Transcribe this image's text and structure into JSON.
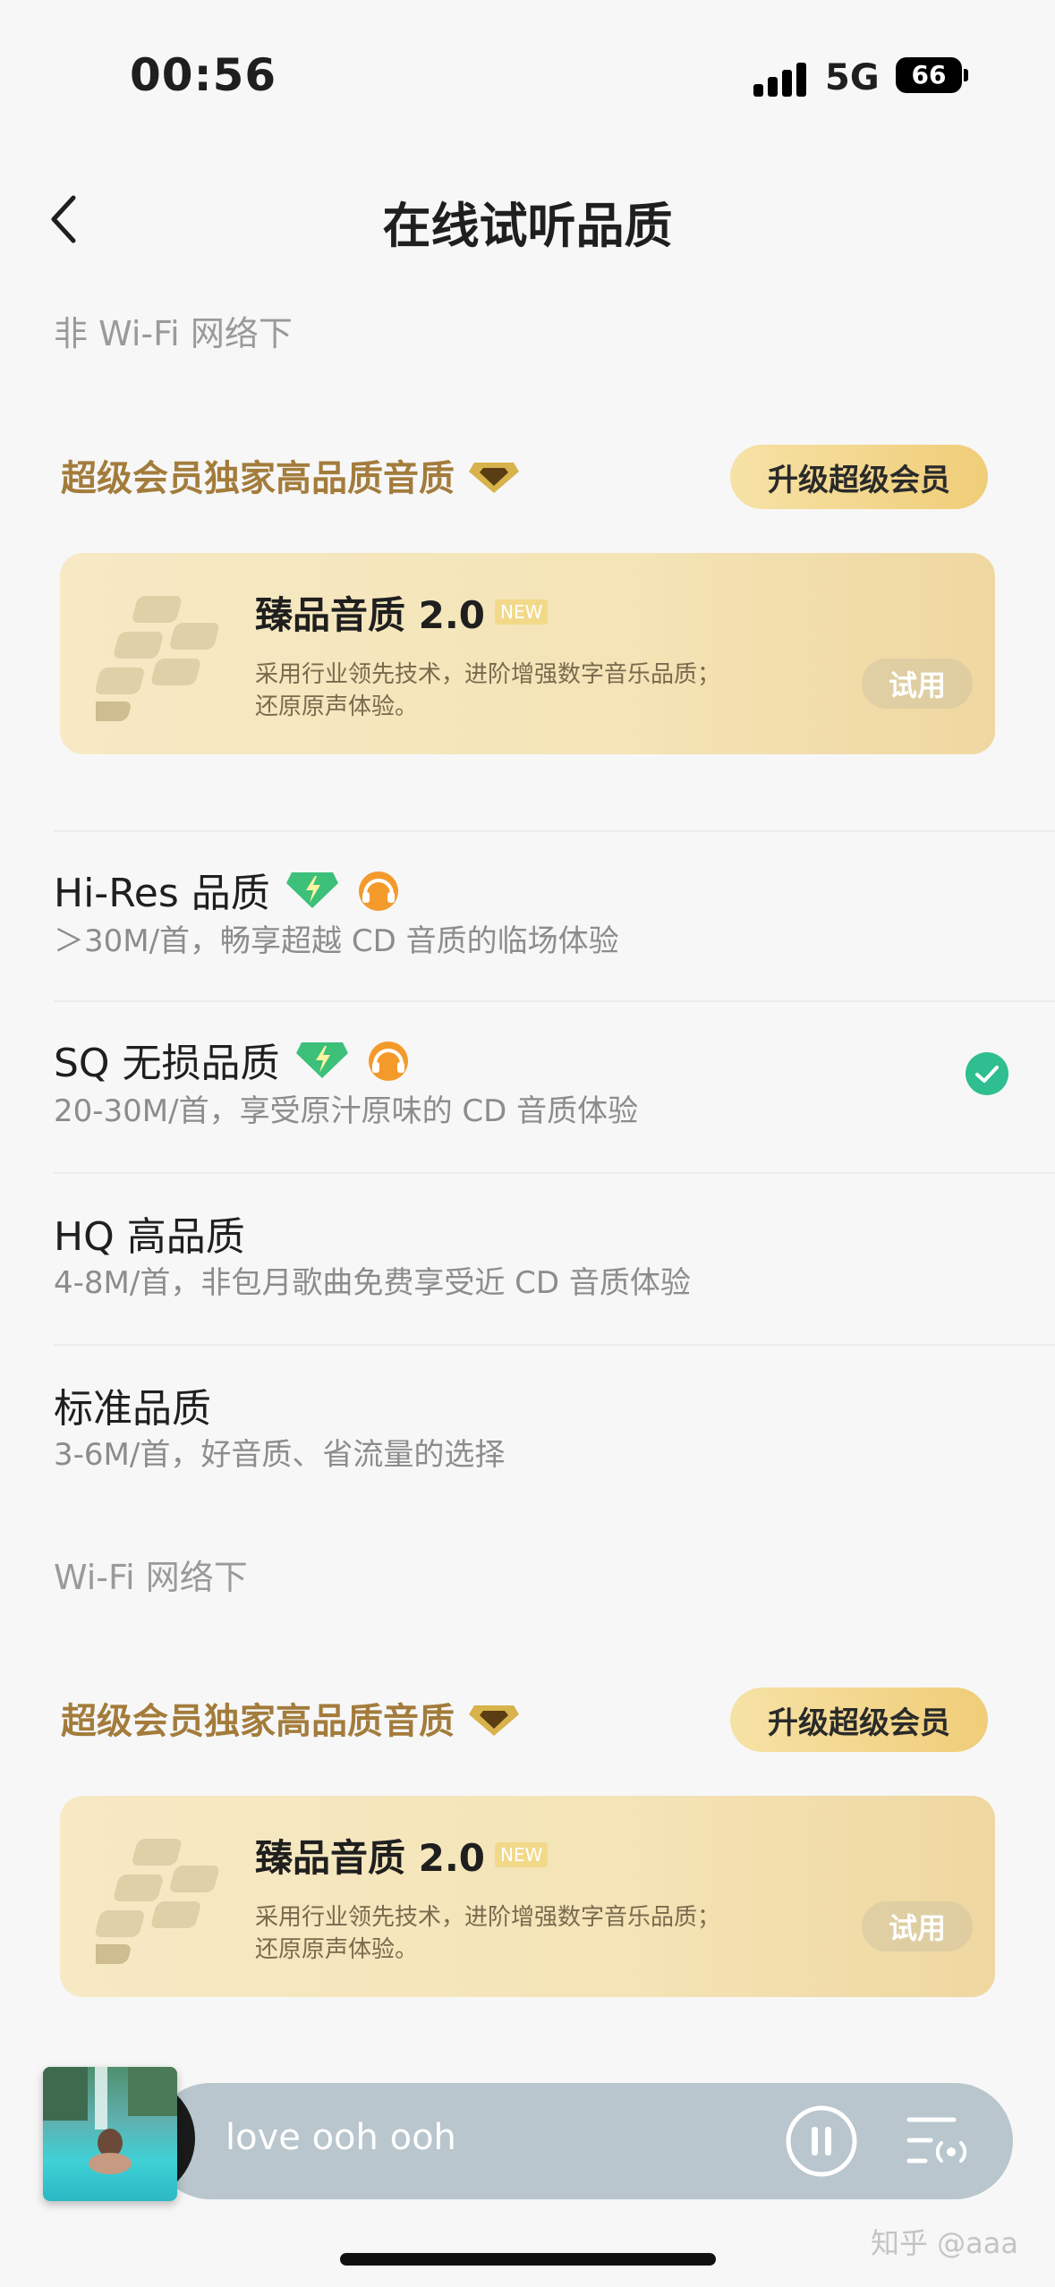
{
  "status_bar": {
    "time": "00:56",
    "network": "5G",
    "battery": "66"
  },
  "nav": {
    "title": "在线试听品质"
  },
  "sections": [
    {
      "label": "非 Wi-Fi 网络下"
    },
    {
      "label": "Wi-Fi 网络下"
    }
  ],
  "promo": {
    "title": "超级会员独家高品质音质",
    "upgrade_label": "升级超级会员",
    "card": {
      "name": "臻品音质 2.0",
      "badge": "NEW",
      "desc_line1": "采用行业领先技术，进阶增强数字音乐品质；",
      "desc_line2": "还原原声体验。",
      "try_label": "试用"
    }
  },
  "options": [
    {
      "title": "Hi-Res 品质",
      "desc": "＞30M/首，畅享超越 CD 音质的临场体验",
      "selected": false
    },
    {
      "title": "SQ 无损品质",
      "desc": "20-30M/首，享受原汁原味的 CD 音质体验",
      "selected": true
    },
    {
      "title": "HQ 高品质",
      "desc": "4-8M/首，非包月歌曲免费享受近 CD 音质体验",
      "selected": false
    },
    {
      "title": "标准品质",
      "desc": "3-6M/首，好音质、省流量的选择",
      "selected": false
    }
  ],
  "player": {
    "song": "love ooh ooh"
  },
  "watermark": "知乎 @aaa",
  "colors": {
    "accent_gold": "#a37c3c",
    "check_green": "#2fbe8f"
  }
}
